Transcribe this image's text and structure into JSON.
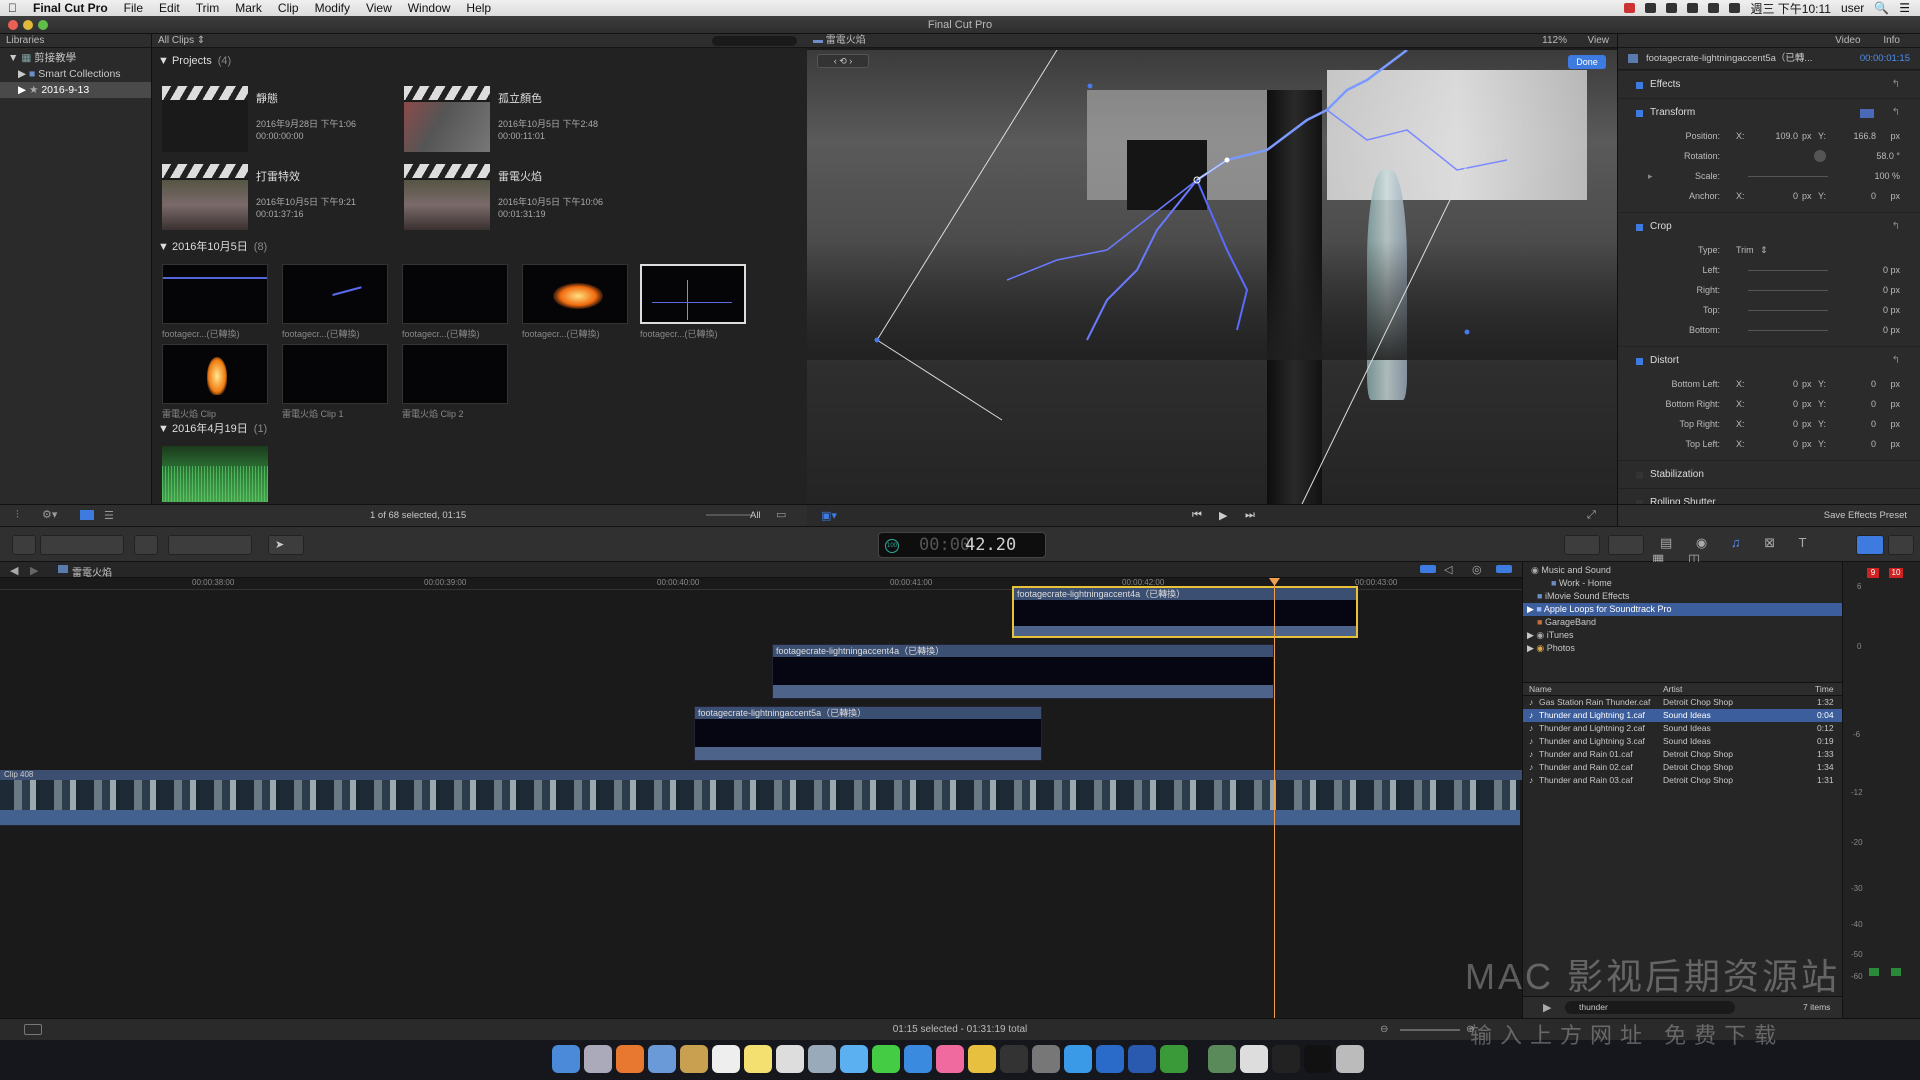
{
  "menubar": {
    "app": "Final Cut Pro",
    "items": [
      "File",
      "Edit",
      "Trim",
      "Mark",
      "Clip",
      "Modify",
      "View",
      "Window",
      "Help"
    ],
    "clock": "週三 下午10:11",
    "user": "user"
  },
  "window": {
    "title": "Final Cut Pro"
  },
  "libraries": {
    "header": "Libraries",
    "library": "剪接教學",
    "items": [
      "Smart Collections",
      "2016-9-13"
    ]
  },
  "browser": {
    "filter": "All Clips",
    "projects_label": "Projects",
    "projects_count": "(4)",
    "projects": [
      {
        "title": "靜態",
        "date": "2016年9月28日 下午1:06",
        "dur": "00:00:00:00"
      },
      {
        "title": "孤立顏色",
        "date": "2016年10月5日 下午2:48",
        "dur": "00:00:11:01"
      },
      {
        "title": "打雷特效",
        "date": "2016年10月5日 下午9:21",
        "dur": "00:01:37:16"
      },
      {
        "title": "雷電火焰",
        "date": "2016年10月5日 下午10:06",
        "dur": "00:01:31:19"
      }
    ],
    "event1": {
      "label": "2016年10月5日",
      "count": "(8)"
    },
    "clips": [
      "footagecr...(已轉換)",
      "footagecr...(已轉換)",
      "footagecr...(已轉換)",
      "footagecr...(已轉換)",
      "footagecr...(已轉換)",
      "雷電火焰 Clip",
      "雷電火焰 Clip 1",
      "雷電火焰 Clip 2"
    ],
    "event2": {
      "label": "2016年4月19日",
      "count": "(1)"
    },
    "footer": "1 of 68 selected, 01:15",
    "footer_all": "All"
  },
  "viewer": {
    "title": "雷電火焰",
    "zoom": "112%",
    "view": "View",
    "done": "Done"
  },
  "inspector": {
    "tabs": [
      "Video",
      "Info"
    ],
    "clip": "footagecrate-lightningaccent5a（已轉...",
    "tc": "00:00:01:15",
    "effects": "Effects",
    "transform": "Transform",
    "position": {
      "label": "Position:",
      "x": "109.0",
      "y": "166.8",
      "unit": "px"
    },
    "rotation": {
      "label": "Rotation:",
      "value": "58.0 °"
    },
    "scale": {
      "label": "Scale:",
      "value": "100 %"
    },
    "anchor": {
      "label": "Anchor:",
      "x": "0",
      "y": "0",
      "unit": "px"
    },
    "crop": "Crop",
    "type_label": "Type:",
    "type_value": "Trim",
    "crop_rows": [
      {
        "label": "Left:",
        "value": "0 px"
      },
      {
        "label": "Right:",
        "value": "0 px"
      },
      {
        "label": "Top:",
        "value": "0 px"
      },
      {
        "label": "Bottom:",
        "value": "0 px"
      }
    ],
    "distort": "Distort",
    "distort_rows": [
      {
        "label": "Bottom Left:",
        "x": "0",
        "y": "0"
      },
      {
        "label": "Bottom Right:",
        "x": "0",
        "y": "0"
      },
      {
        "label": "Top Right:",
        "x": "0",
        "y": "0"
      },
      {
        "label": "Top Left:",
        "x": "0",
        "y": "0"
      }
    ],
    "stabilization": "Stabilization",
    "rolling": "Rolling Shutter",
    "save_preset": "Save Effects Preset"
  },
  "timecode": {
    "value": "42.20",
    "pct": "100"
  },
  "timeline": {
    "project": "雷電火焰",
    "ticks": [
      "00:00:38:00",
      "00:00:39:00",
      "00:00:40:00",
      "00:00:41:00",
      "00:00:42:00",
      "00:00:43:00"
    ],
    "clip_a": "footagecrate-lightningaccent4a（已轉換）",
    "clip_b": "footagecrate-lightningaccent4a（已轉換）",
    "clip_c": "footagecrate-lightningaccent5a（已轉換）",
    "main_label": "Clip 408"
  },
  "sound": {
    "root": "Music and Sound",
    "items": [
      "Work - Home",
      "iMovie Sound Effects",
      "Apple Loops for Soundtrack Pro",
      "GarageBand",
      "iTunes",
      "Photos"
    ],
    "cols": [
      "Name",
      "Artist",
      "Time"
    ],
    "rows": [
      {
        "name": "Gas Station Rain Thunder.caf",
        "artist": "Detroit Chop Shop",
        "time": "1:32"
      },
      {
        "name": "Thunder and Lightning 1.caf",
        "artist": "Sound Ideas",
        "time": "0:04"
      },
      {
        "name": "Thunder and Lightning 2.caf",
        "artist": "Sound Ideas",
        "time": "0:12"
      },
      {
        "name": "Thunder and Lightning 3.caf",
        "artist": "Sound Ideas",
        "time": "0:19"
      },
      {
        "name": "Thunder and Rain 01.caf",
        "artist": "Detroit Chop Shop",
        "time": "1:33"
      },
      {
        "name": "Thunder and Rain 02.caf",
        "artist": "Detroit Chop Shop",
        "time": "1:34"
      },
      {
        "name": "Thunder and Rain 03.caf",
        "artist": "Detroit Chop Shop",
        "time": "1:31"
      }
    ],
    "search": "thunder",
    "count": "7 items"
  },
  "meter": {
    "ticks": [
      "6",
      "0",
      "-6",
      "-12",
      "-20",
      "-30",
      "-40",
      "-50",
      "-60"
    ],
    "peak_l": "9",
    "peak_r": "10"
  },
  "status": "01:15 selected - 01:31:19 total",
  "watermark": {
    "line1": "MAC 影视后期资源站",
    "line2": "输入上方网址 免费下载"
  }
}
